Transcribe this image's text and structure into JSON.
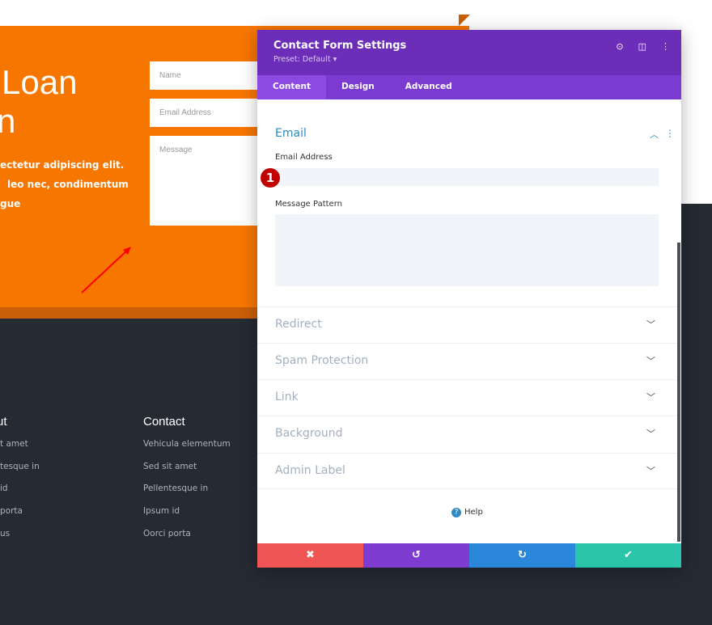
{
  "hero": {
    "title_line1": "Loan",
    "title_line2": "n",
    "text_lines": [
      "ectetur adipiscing elit.",
      "leo nec, condimentum",
      "gue"
    ]
  },
  "form": {
    "name_placeholder": "Name",
    "email_placeholder": "Email Address",
    "message_placeholder": "Message"
  },
  "footer": {
    "col1": {
      "title": "ut",
      "items": [
        "t amet",
        "tesque in",
        "id",
        "porta",
        "us"
      ]
    },
    "col2": {
      "title": "Contact",
      "items": [
        "Vehicula elementum",
        "Sed sit amet",
        "Pellentesque in",
        "Ipsum id",
        "Oorci porta"
      ]
    }
  },
  "panel": {
    "title": "Contact Form Settings",
    "preset": "Preset: Default ▾",
    "tabs": [
      "Content",
      "Design",
      "Advanced"
    ],
    "section": "Email",
    "email_label": "Email Address",
    "email_value": "",
    "message_label": "Message Pattern",
    "message_value": "",
    "badge": "1",
    "collapsed": [
      "Redirect",
      "Spam Protection",
      "Link",
      "Background",
      "Admin Label"
    ],
    "help": "Help",
    "buttons": {
      "cancel": "✖",
      "undo": "↺",
      "redo": "↻",
      "save": "✔"
    }
  },
  "colors": {
    "orange": "#f77600",
    "purple": "#6c2eb9",
    "cancel": "#ef5555",
    "undo": "#7d3bcf",
    "redo": "#2b87da",
    "save": "#29c4a9"
  }
}
